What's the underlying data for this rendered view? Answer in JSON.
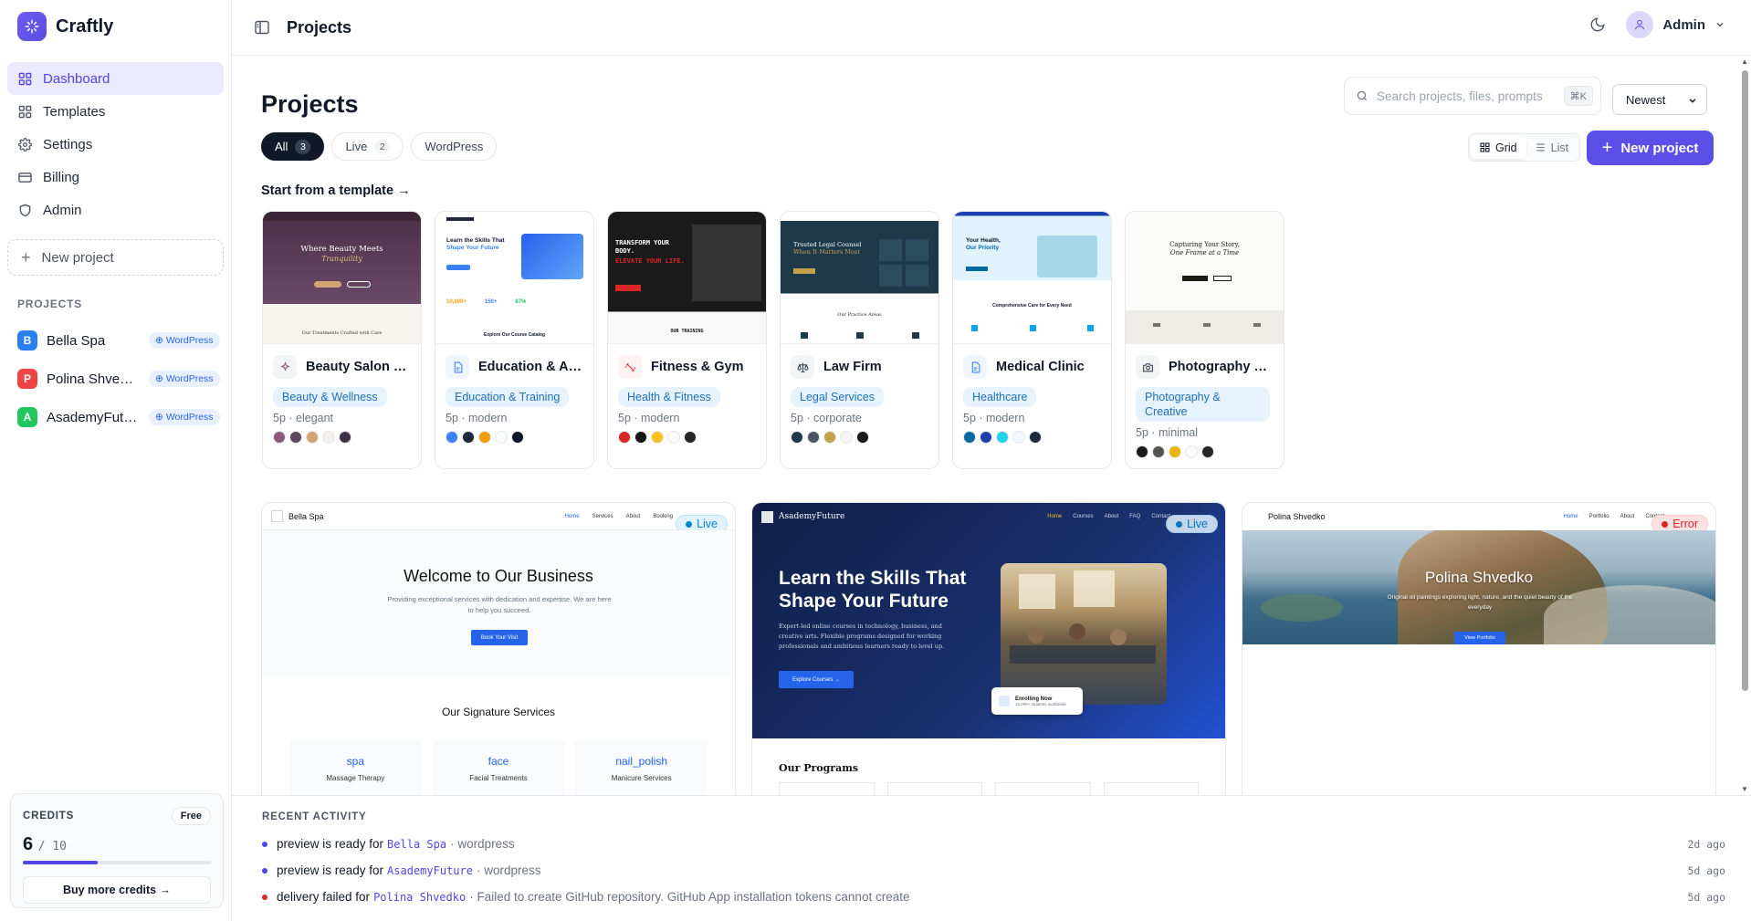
{
  "brand": {
    "name": "Craftly"
  },
  "nav": [
    {
      "label": "Dashboard",
      "icon": "grid-icon",
      "active": true
    },
    {
      "label": "Templates",
      "icon": "grid-icon",
      "active": false
    },
    {
      "label": "Settings",
      "icon": "gear-icon",
      "active": false
    },
    {
      "label": "Billing",
      "icon": "card-icon",
      "active": false
    },
    {
      "label": "Admin",
      "icon": "shield-icon",
      "active": false
    }
  ],
  "sidebar": {
    "new_project": "New project",
    "projects_label": "PROJECTS",
    "projects": [
      {
        "initial": "B",
        "name": "Bella Spa",
        "badge": "WordPress",
        "color": "#2b7ff1"
      },
      {
        "initial": "P",
        "name": "Polina Shvedko",
        "badge": "WordPress",
        "color": "#ef4444"
      },
      {
        "initial": "A",
        "name": "AsademyFuture",
        "badge": "WordPress",
        "color": "#22c55e"
      }
    ],
    "credits": {
      "label": "CREDITS",
      "plan": "Free",
      "used": "6",
      "total": "/ 10",
      "fraction": 0.4,
      "buy": "Buy more credits →"
    }
  },
  "topbar": {
    "title": "Projects",
    "user": "Admin"
  },
  "main": {
    "title": "Projects",
    "filters": [
      {
        "label": "All",
        "count": "3",
        "active": true
      },
      {
        "label": "Live",
        "count": "2",
        "active": false
      },
      {
        "label": "WordPress",
        "count": "",
        "active": false
      }
    ],
    "search_placeholder": "Search projects, files, prompts",
    "search_kbd": "⌘K",
    "sort": "Newest",
    "view": {
      "grid": "Grid",
      "list": "List"
    },
    "new_project": "New project",
    "template_link": "Start from a template →"
  },
  "templates": [
    {
      "name": "Beauty Salon & Spa",
      "category": "Beauty & Wellness",
      "meta": "5p · elegant",
      "colors": [
        "#8b5a7a",
        "#5b4a5e",
        "#d4a373",
        "#f5f0eb",
        "#3d3340"
      ],
      "thumb": {
        "bg": "#4a2f48",
        "headline": "Where Beauty Meets",
        "accent": "Tranquility",
        "lower_text": "Our Treatments Crafted with Care"
      }
    },
    {
      "name": "Education & Academy",
      "category": "Education & Training",
      "meta": "5p · modern",
      "colors": [
        "#3b82f6",
        "#1e293b",
        "#f59e0b",
        "#f8fafc",
        "#0f172a"
      ],
      "thumb": {
        "headline": "Learn the Skills That",
        "accent": "Shape Your Future",
        "stats": [
          "10,000+",
          "150+",
          "87%"
        ],
        "lower_text": "Explore Our Course Catalog"
      }
    },
    {
      "name": "Fitness & Gym",
      "category": "Health & Fitness",
      "meta": "5p · modern",
      "colors": [
        "#dc2626",
        "#171717",
        "#fbbf24",
        "#fafafa",
        "#262626"
      ],
      "thumb": {
        "bg": "#1a1a1a",
        "headline": "TRANSFORM YOUR BODY.",
        "accent": "ELEVATE YOUR LIFE.",
        "lower_text": "OUR TRAINING"
      }
    },
    {
      "name": "Law Firm",
      "category": "Legal Services",
      "meta": "5p · corporate",
      "colors": [
        "#1e3a4a",
        "#4b5563",
        "#c4a24a",
        "#f5f5f4",
        "#1c1917"
      ],
      "thumb": {
        "bg": "#1e3a4a",
        "headline": "Trusted Legal Counsel",
        "accent": "When It Matters Most",
        "lower_text": "Our Practice Areas"
      }
    },
    {
      "name": "Medical Clinic",
      "category": "Healthcare",
      "meta": "5p · modern",
      "colors": [
        "#0369a1",
        "#1e40af",
        "#22d3ee",
        "#f0f9ff",
        "#1e293b"
      ],
      "thumb": {
        "headline": "Your Health,",
        "accent": "Our Priority",
        "lower_text": "Comprehensive Care for Every Need"
      }
    },
    {
      "name": "Photography Studio",
      "category": "Photography & Creative",
      "meta": "5p · minimal",
      "colors": [
        "#1c1917",
        "#57534e",
        "#eab308",
        "#fafaf9",
        "#292524"
      ],
      "thumb": {
        "headline": "Capturing Your Story,",
        "accent": "One Frame at a Time"
      }
    }
  ],
  "projects": [
    {
      "name": "Bella Spa",
      "status": "Live",
      "preview": {
        "nav": [
          "Home",
          "Services",
          "About",
          "Booking"
        ],
        "headline": "Welcome to Our Business",
        "sub": "Providing exceptional services with dedication and expertise. We are here to help you succeed.",
        "cta": "Book Your Visit",
        "section": "Our Signature Services",
        "services": [
          {
            "icon": "spa",
            "title": "Massage Therapy"
          },
          {
            "icon": "face",
            "title": "Facial Treatments"
          },
          {
            "icon": "nail_polish",
            "title": "Manicure Services"
          }
        ]
      }
    },
    {
      "name": "AsademyFuture",
      "status": "Live",
      "preview": {
        "nav": [
          "Home",
          "Courses",
          "About",
          "FAQ",
          "Contact"
        ],
        "headline": "Learn the Skills That Shape Your Future",
        "sub": "Expert-led online courses in technology, business, and creative arts. Flexible programs designed for working professionals and ambitious learners ready to level up.",
        "cta": "Explore Courses →",
        "badge_title": "Enrolling Now",
        "badge_sub": "10,000+ students worldwide",
        "section": "Our Programs"
      }
    },
    {
      "name": "Polina Shvedko",
      "status": "Error",
      "preview": {
        "nav": [
          "Home",
          "Portfolio",
          "About",
          "Contact"
        ],
        "headline": "Polina Shvedko",
        "sub": "Original oil paintings exploring light, nature, and the quiet beauty of the everyday",
        "cta": "View Portfolio"
      }
    }
  ],
  "activity": {
    "label": "RECENT ACTIVITY",
    "items": [
      {
        "text": "preview is ready for",
        "code": "Bella Spa",
        "suffix": "· wordpress",
        "time": "2d ago",
        "color": "#4f46e5"
      },
      {
        "text": "preview is ready for",
        "code": "AsademyFuture",
        "suffix": "· wordpress",
        "time": "5d ago",
        "color": "#4f46e5"
      },
      {
        "text": "delivery failed for",
        "code": "Polina Shvedko",
        "suffix": "· Failed to create GitHub repository. GitHub App installation tokens cannot create",
        "time": "5d ago",
        "color": "#dc2626"
      }
    ]
  }
}
